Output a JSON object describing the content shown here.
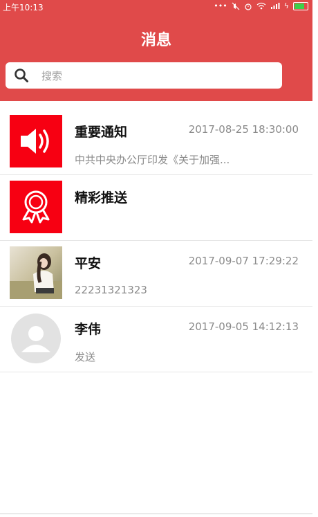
{
  "status": {
    "time": "上午10:13",
    "icons": [
      "dots-icon",
      "mute-icon",
      "alarm-icon",
      "wifi-icon",
      "signal-icon",
      "charging-icon",
      "battery-icon"
    ]
  },
  "header": {
    "title": "消息",
    "background": "#e04a4a"
  },
  "search": {
    "placeholder": "搜索",
    "value": ""
  },
  "messages": [
    {
      "name": "重要通知",
      "time": "2017-08-25 18:30:00",
      "preview": "中共中央办公厅印发《关于加强...",
      "avatar": "speaker-icon",
      "avatar_color": "#f70012"
    },
    {
      "name": "精彩推送",
      "time": "",
      "preview": "",
      "avatar": "award-ribbon-icon",
      "avatar_color": "#f70012"
    },
    {
      "name": "平安",
      "time": "2017-09-07 17:29:22",
      "preview": "22231321323",
      "avatar": "photo-avatar"
    },
    {
      "name": "李伟",
      "time": "2017-09-05 14:12:13",
      "preview": "发送",
      "avatar": "default-user-icon"
    }
  ]
}
